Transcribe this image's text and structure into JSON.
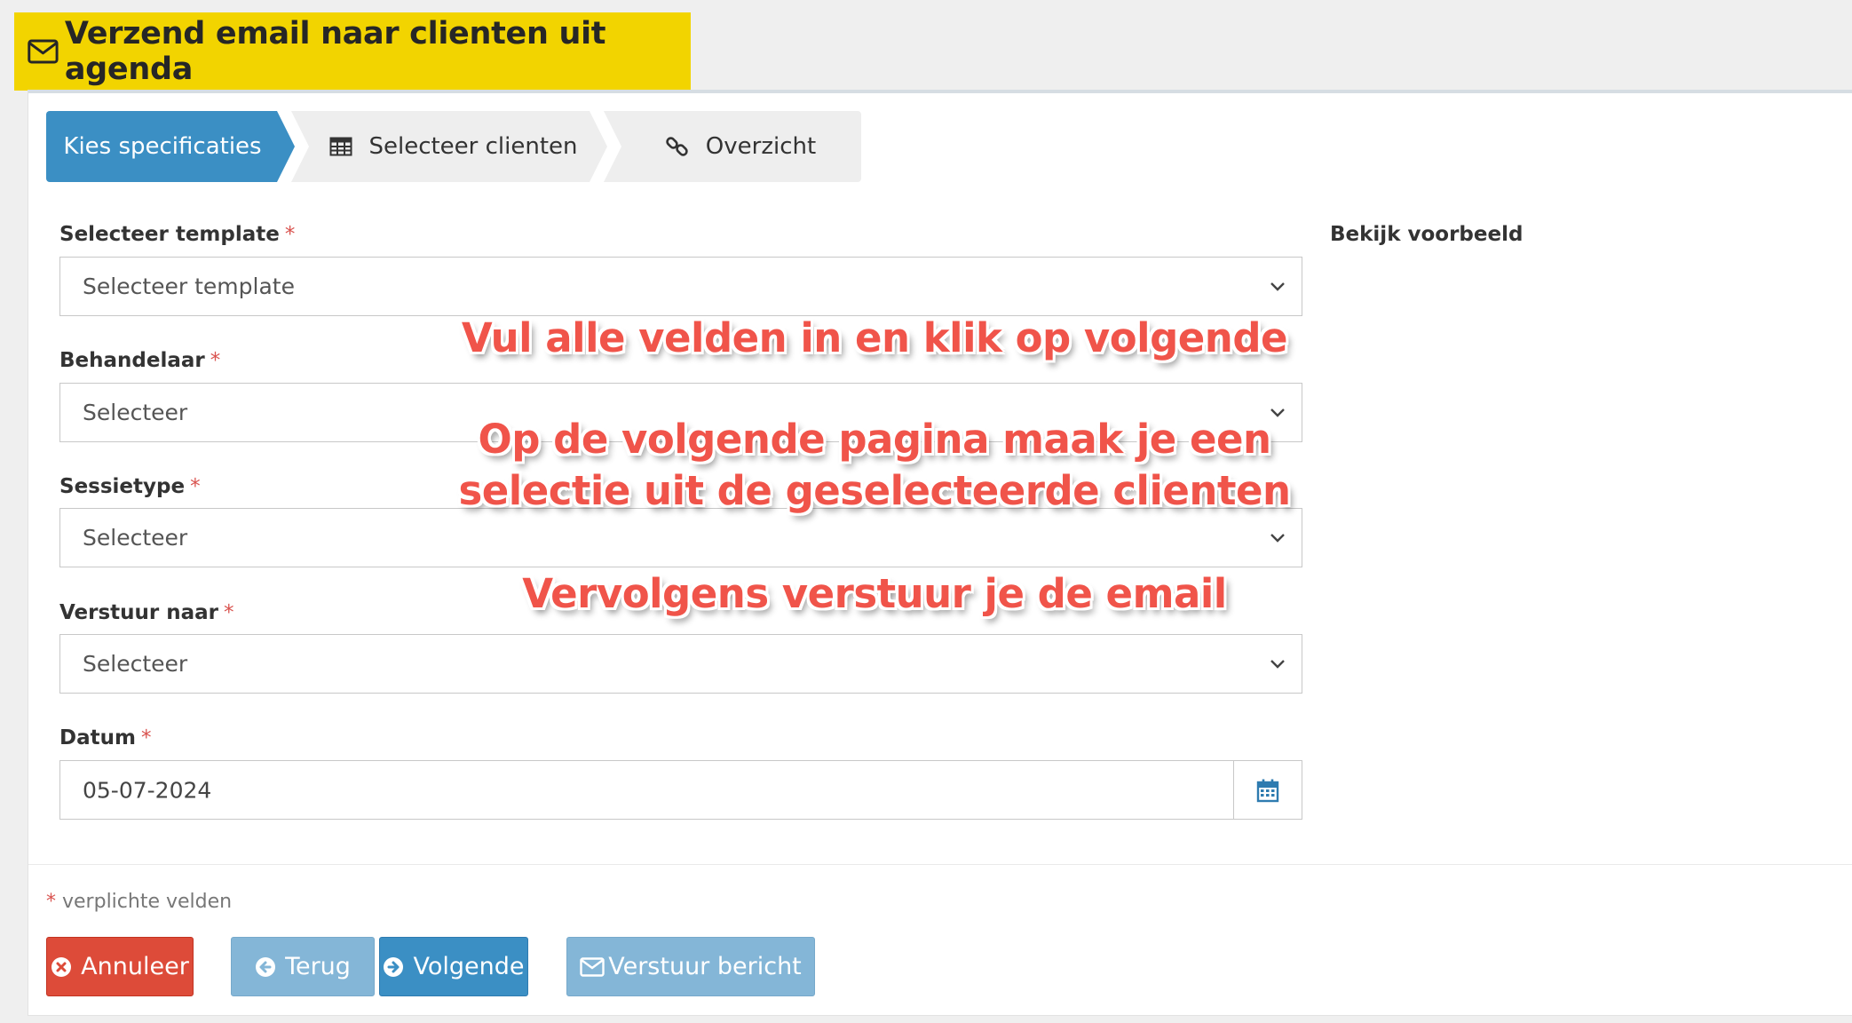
{
  "header": {
    "title": "Verzend email naar clienten uit agenda"
  },
  "wizard": {
    "steps": [
      {
        "label": "Kies specificaties",
        "icon": "none",
        "active": true
      },
      {
        "label": "Selecteer clienten",
        "icon": "table-icon",
        "active": false
      },
      {
        "label": "Overzicht",
        "icon": "link-icon",
        "active": false
      }
    ]
  },
  "form": {
    "required_mark": "*",
    "template": {
      "label": "Selecteer template",
      "value": "Selecteer template"
    },
    "behandelaar": {
      "label": "Behandelaar",
      "value": "Selecteer"
    },
    "sessietype": {
      "label": "Sessietype",
      "value": "Selecteer"
    },
    "verstuur_naar": {
      "label": "Verstuur naar",
      "value": "Selecteer"
    },
    "datum": {
      "label": "Datum",
      "value": "05-07-2024"
    }
  },
  "preview": {
    "label": "Bekijk voorbeeld"
  },
  "footer": {
    "required_note": "verplichte velden",
    "required_star": "*"
  },
  "buttons": {
    "cancel": "Annuleer",
    "back": "Terug",
    "next": "Volgende",
    "send": "Verstuur bericht"
  },
  "annotations": {
    "line1": "Vul alle velden in en klik op volgende",
    "line2a": "Op de volgende pagina maak je een",
    "line2b": "selectie uit de geselecteerde clienten",
    "line3": "Vervolgens verstuur je de email"
  },
  "colors": {
    "title_bg": "#f2d400",
    "primary": "#3b8fc4",
    "primary_light": "#84b6d7",
    "danger": "#dd4b39",
    "annotation": "#f0544a"
  }
}
